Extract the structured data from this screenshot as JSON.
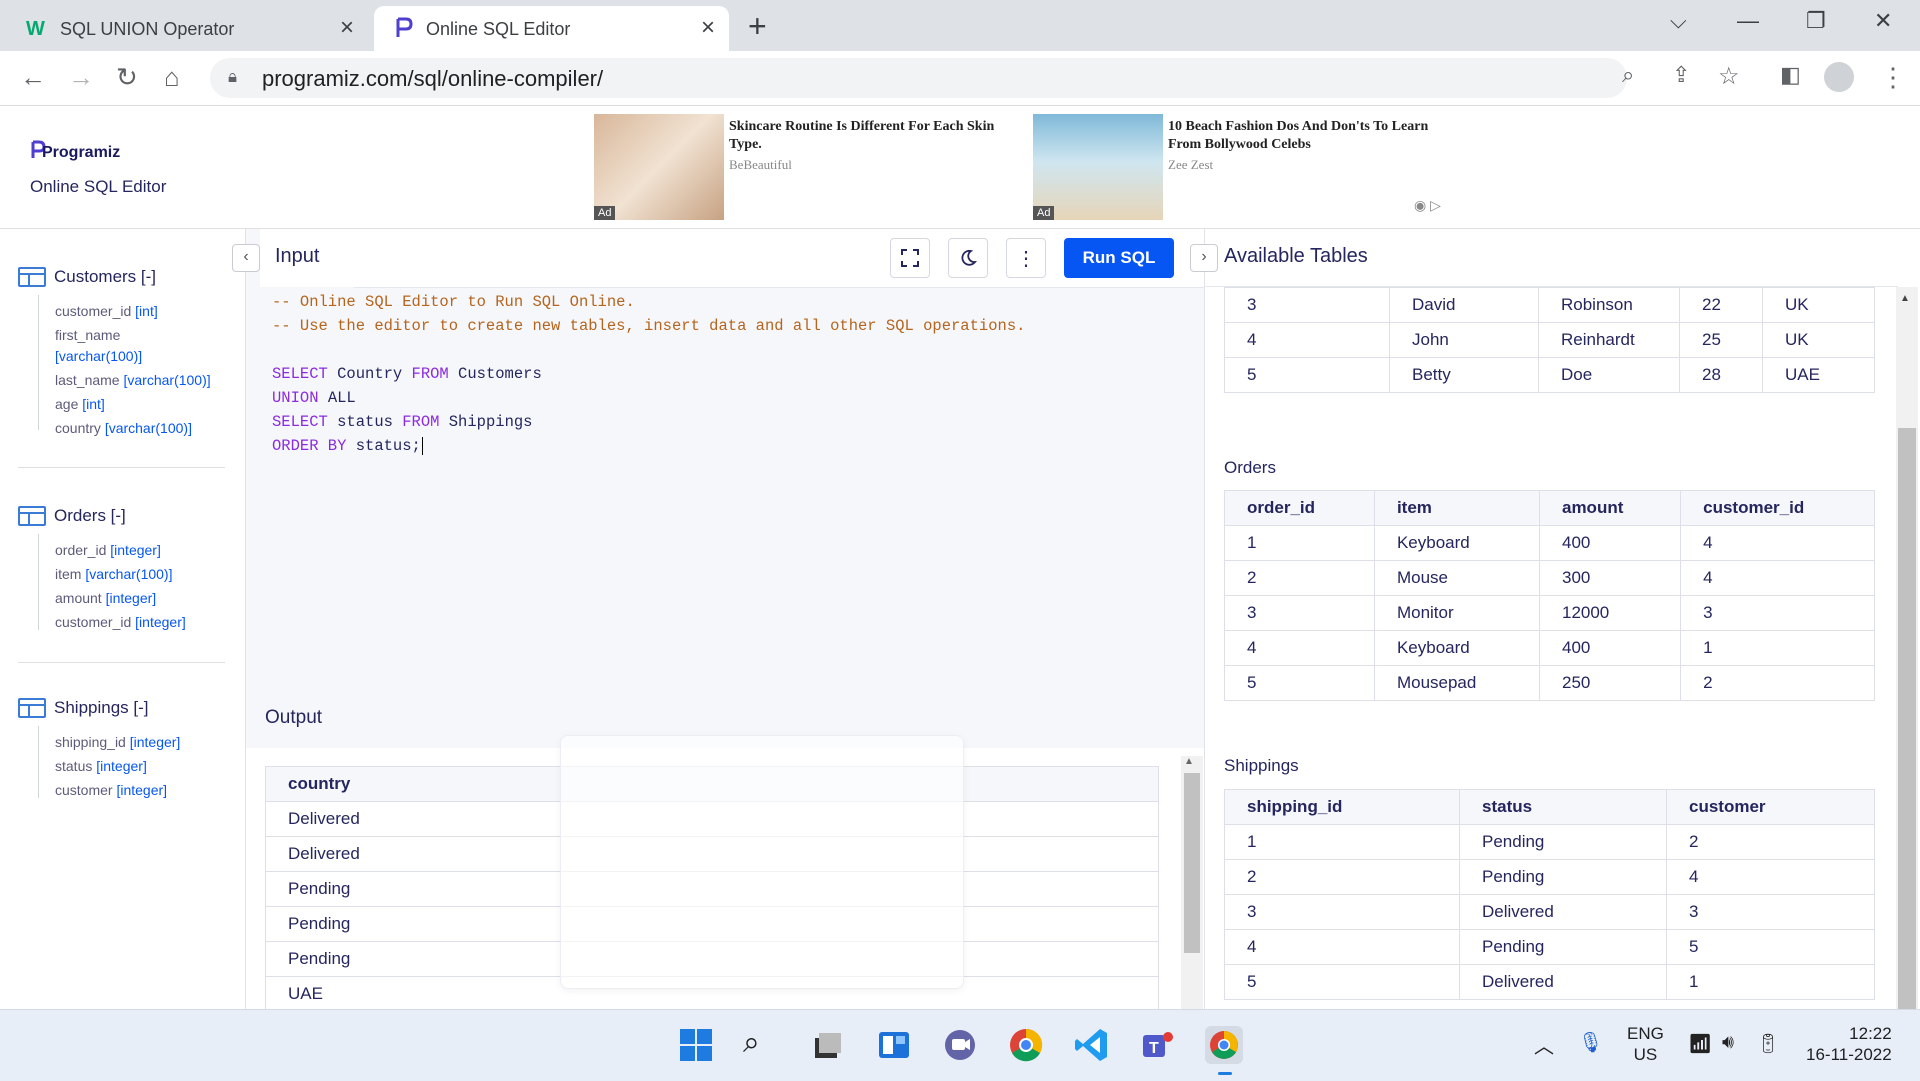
{
  "browser": {
    "tabs": [
      {
        "title": "SQL UNION Operator",
        "icon": "w3schools-icon",
        "active": false
      },
      {
        "title": "Online SQL Editor",
        "icon": "programiz-icon",
        "active": true
      }
    ],
    "url": "programiz.com/sql/online-compiler/"
  },
  "header": {
    "logo": "Programiz",
    "subtitle": "Online SQL Editor"
  },
  "ads": [
    {
      "title": "Skincare Routine Is Different For Each Skin Type.",
      "source": "BeBeautiful",
      "badge": "Ad"
    },
    {
      "title": "10 Beach Fashion Dos And Don'ts To Learn From Bollywood Celebs",
      "source": "Zee Zest",
      "badge": "Ad"
    }
  ],
  "sidebar": {
    "tables": [
      {
        "name": "Customers [-]",
        "columns": [
          {
            "name": "customer_id",
            "type": "[int]"
          },
          {
            "name": "first_name",
            "type": "[varchar(100)]"
          },
          {
            "name": "last_name",
            "type": "[varchar(100)]"
          },
          {
            "name": "age",
            "type": "[int]"
          },
          {
            "name": "country",
            "type": "[varchar(100)]"
          }
        ]
      },
      {
        "name": "Orders [-]",
        "columns": [
          {
            "name": "order_id",
            "type": "[integer]"
          },
          {
            "name": "item",
            "type": "[varchar(100)]"
          },
          {
            "name": "amount",
            "type": "[integer]"
          },
          {
            "name": "customer_id",
            "type": "[integer]"
          }
        ]
      },
      {
        "name": "Shippings [-]",
        "columns": [
          {
            "name": "shipping_id",
            "type": "[integer]"
          },
          {
            "name": "status",
            "type": "[integer]"
          },
          {
            "name": "customer",
            "type": "[integer]"
          }
        ]
      }
    ]
  },
  "editor": {
    "tab_label": "Input",
    "run_label": "Run SQL",
    "lines": {
      "l1": "-- Online SQL Editor to Run SQL Online.",
      "l2": "-- Use the editor to create new tables, insert data and all other SQL operations.",
      "l4a": "SELECT",
      "l4b": " Country ",
      "l4c": "FROM",
      "l4d": " Customers",
      "l5a": "UNION",
      "l5b": " ALL",
      "l6a": "SELECT",
      "l6b": " status ",
      "l6c": "FROM",
      "l6d": " Shippings",
      "l7a": "ORDER BY",
      "l7b": " status;"
    }
  },
  "output": {
    "label": "Output",
    "header": "country",
    "rows": [
      "Delivered",
      "Delivered",
      "Pending",
      "Pending",
      "Pending",
      "UAE"
    ]
  },
  "right": {
    "title": "Available Tables",
    "customers_rows": [
      [
        "3",
        "David",
        "Robinson",
        "22",
        "UK"
      ],
      [
        "4",
        "John",
        "Reinhardt",
        "25",
        "UK"
      ],
      [
        "5",
        "Betty",
        "Doe",
        "28",
        "UAE"
      ]
    ],
    "orders_label": "Orders",
    "orders_headers": [
      "order_id",
      "item",
      "amount",
      "customer_id"
    ],
    "orders_rows": [
      [
        "1",
        "Keyboard",
        "400",
        "4"
      ],
      [
        "2",
        "Mouse",
        "300",
        "4"
      ],
      [
        "3",
        "Monitor",
        "12000",
        "3"
      ],
      [
        "4",
        "Keyboard",
        "400",
        "1"
      ],
      [
        "5",
        "Mousepad",
        "250",
        "2"
      ]
    ],
    "shippings_label": "Shippings",
    "shippings_headers": [
      "shipping_id",
      "status",
      "customer"
    ],
    "shippings_rows": [
      [
        "1",
        "Pending",
        "2"
      ],
      [
        "2",
        "Pending",
        "4"
      ],
      [
        "3",
        "Delivered",
        "3"
      ],
      [
        "4",
        "Pending",
        "5"
      ],
      [
        "5",
        "Delivered",
        "1"
      ]
    ]
  },
  "taskbar": {
    "lang1": "ENG",
    "lang2": "US",
    "time": "12:22",
    "date": "16-11-2022"
  },
  "colors": {
    "accent": "#0556f3",
    "text": "#25265e",
    "comment": "#b5651d",
    "keyword": "#8a2be2"
  }
}
